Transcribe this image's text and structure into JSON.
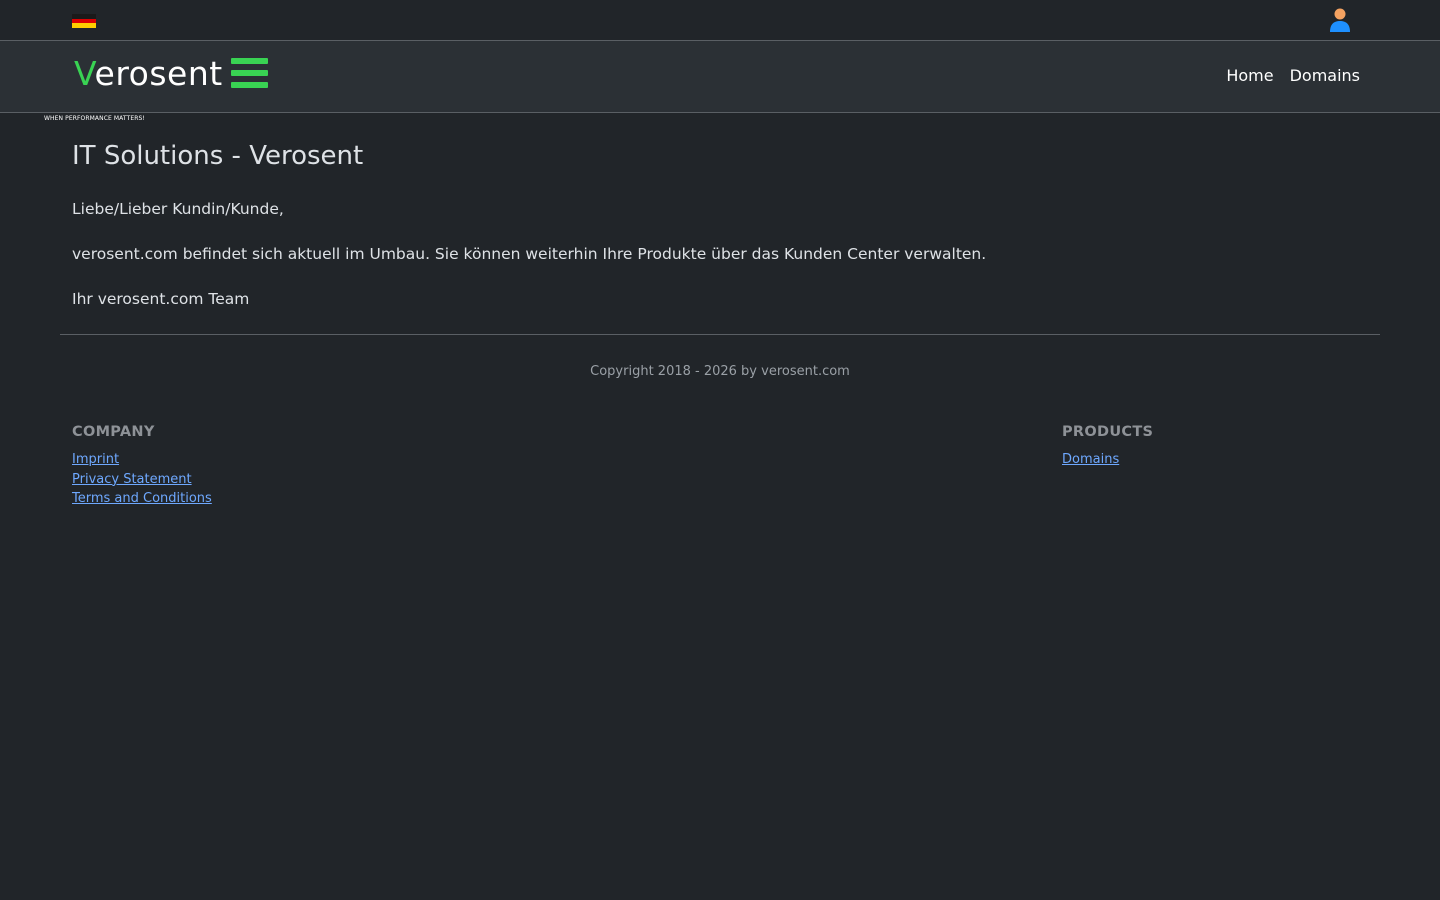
{
  "topbar": {
    "language_flag": "germany-flag",
    "user_icon": "user-icon"
  },
  "brand": {
    "logo_first_letter": "V",
    "logo_rest": "erosent",
    "tagline": "WHEN PERFORMANCE MATTERS!",
    "accent_color": "#39d353"
  },
  "nav": {
    "items": [
      {
        "label": "Home"
      },
      {
        "label": "Domains"
      }
    ]
  },
  "main": {
    "title": "IT Solutions - Verosent",
    "paragraphs": [
      "Liebe/Lieber Kundin/Kunde,",
      "verosent.com befindet sich aktuell im Umbau. Sie können weiterhin Ihre Produkte über das Kunden Center verwalten.",
      "Ihr verosent.com Team"
    ]
  },
  "footer": {
    "copyright": "Copyright  2018 - 2026 by verosent.com",
    "company": {
      "heading": "COMPANY",
      "links": [
        "Imprint",
        "Privacy Statement",
        "Terms and Conditions"
      ]
    },
    "products": {
      "heading": "PRODUCTS",
      "links": [
        "Domains"
      ]
    }
  }
}
